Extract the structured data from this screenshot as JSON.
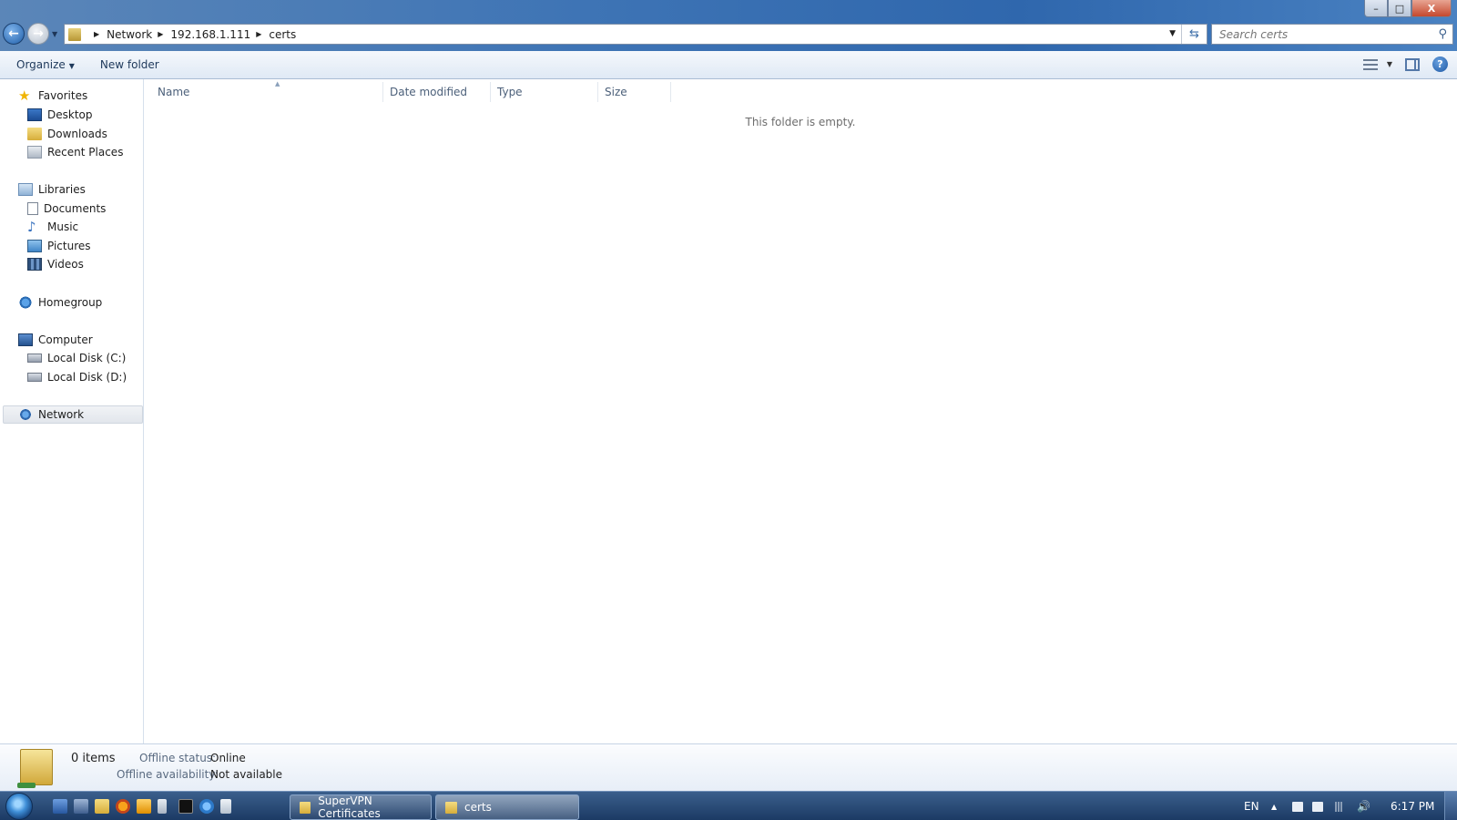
{
  "window": {
    "controls": {
      "minimize": "–",
      "maximize": "□",
      "close": "X"
    }
  },
  "address": {
    "crumbs": [
      "Network",
      "192.168.1.111",
      "certs"
    ]
  },
  "search": {
    "placeholder": "Search certs"
  },
  "toolbar": {
    "organize_label": "Organize",
    "new_folder_label": "New folder"
  },
  "nav": {
    "favorites": "Favorites",
    "desktop": "Desktop",
    "downloads": "Downloads",
    "recent_places": "Recent Places",
    "libraries": "Libraries",
    "documents": "Documents",
    "music": "Music",
    "pictures": "Pictures",
    "videos": "Videos",
    "homegroup": "Homegroup",
    "computer": "Computer",
    "disk_c": "Local Disk (C:)",
    "disk_d": "Local Disk (D:)",
    "network": "Network"
  },
  "columns": {
    "name": "Name",
    "date_modified": "Date modified",
    "type": "Type",
    "size": "Size"
  },
  "content": {
    "empty_message": "This folder is empty."
  },
  "details": {
    "items_count": "0 items",
    "offline_status_label": "Offline status:",
    "offline_status_value": "Online",
    "offline_availability_label": "Offline availability:",
    "offline_availability_value": "Not available"
  },
  "taskbar": {
    "windows": [
      "SuperVPN Certificates",
      "certs"
    ],
    "language": "EN",
    "clock": "6:17 PM"
  }
}
